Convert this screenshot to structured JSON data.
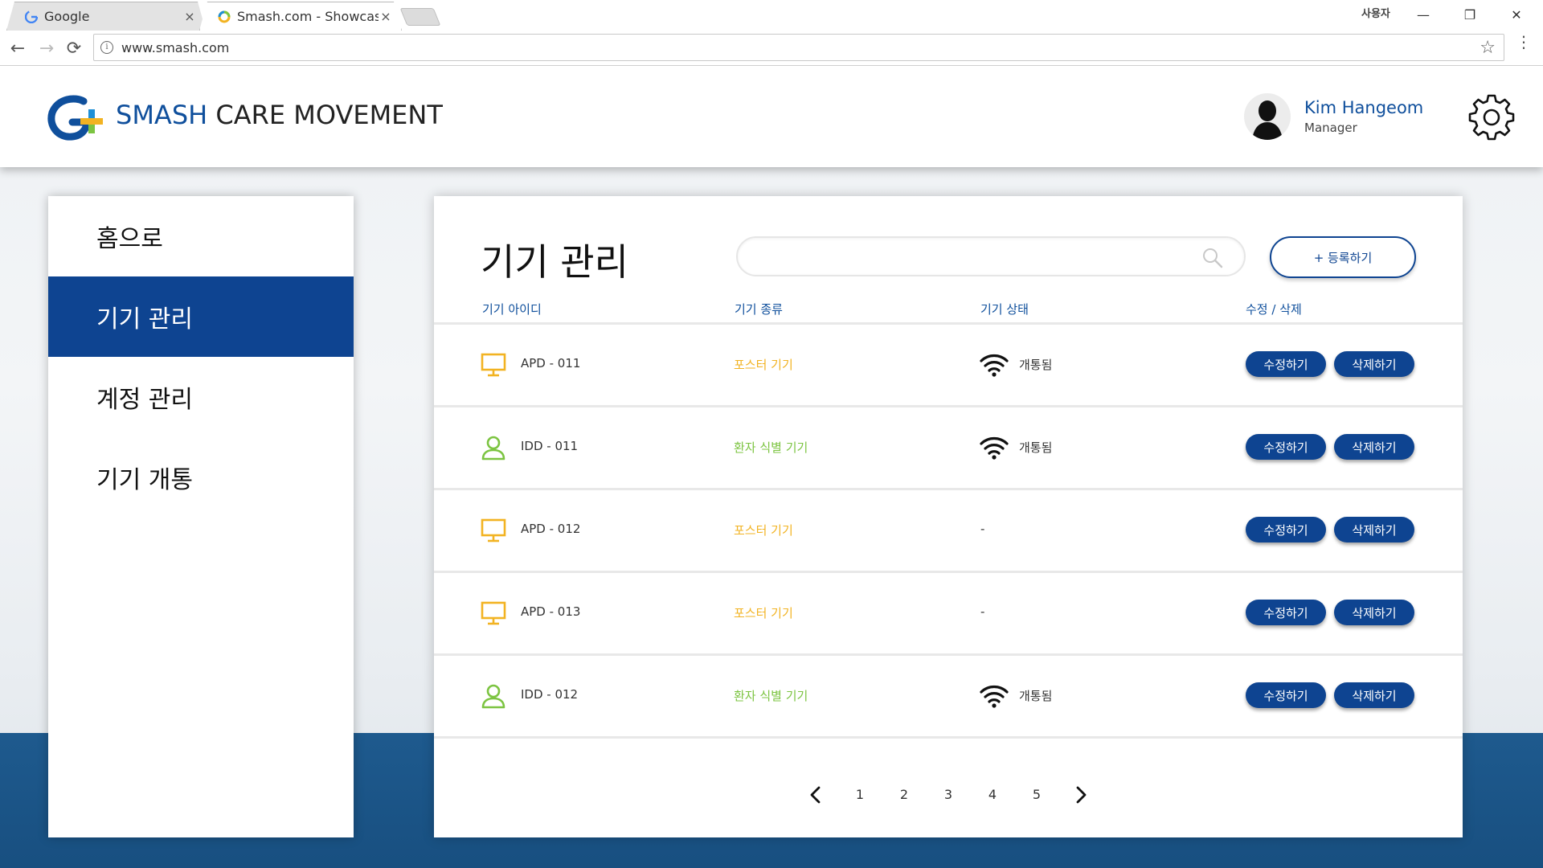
{
  "browser": {
    "tabs": [
      {
        "title": "Google",
        "close": "×"
      },
      {
        "title": "Smash.com - Showcasin",
        "close": "×"
      }
    ],
    "window_user": "사용자",
    "window_controls": {
      "minimize": "—",
      "restore": "❐",
      "close": "✕"
    },
    "url": "www.smash.com",
    "nav": {
      "back": "←",
      "forward": "→",
      "reload": "⟳"
    },
    "star": "☆",
    "menu": "⋮"
  },
  "header": {
    "brand_blue": "SMASH",
    "brand_dark": "CARE MOVEMENT",
    "user_name": "Kim Hangeom",
    "user_role": "Manager"
  },
  "sidebar": {
    "items": [
      {
        "label": "홈으로",
        "active": false
      },
      {
        "label": "기기 관리",
        "active": true
      },
      {
        "label": "계정 관리",
        "active": false
      },
      {
        "label": "기기 개통",
        "active": false
      }
    ]
  },
  "main": {
    "title": "기기 관리",
    "search_placeholder": "",
    "add_button": "+ 등록하기",
    "columns": [
      "기기 아이디",
      "기기 종류",
      "기기 상태",
      "수정 / 삭제"
    ],
    "rows": [
      {
        "icon": "monitor-icon",
        "id": "APD - 011",
        "type": "포스터 기기",
        "type_kind": "poster",
        "status": "개통됨",
        "wifi": true
      },
      {
        "icon": "person-icon",
        "id": "IDD - 011",
        "type": "환자 식별 기기",
        "type_kind": "patient",
        "status": "개통됨",
        "wifi": true
      },
      {
        "icon": "monitor-icon",
        "id": "APD - 012",
        "type": "포스터 기기",
        "type_kind": "poster",
        "status": "-",
        "wifi": false
      },
      {
        "icon": "monitor-icon",
        "id": "APD - 013",
        "type": "포스터 기기",
        "type_kind": "poster",
        "status": "-",
        "wifi": false
      },
      {
        "icon": "person-icon",
        "id": "IDD - 012",
        "type": "환자 식별 기기",
        "type_kind": "patient",
        "status": "개통됨",
        "wifi": true
      }
    ],
    "edit_label": "수정하기",
    "delete_label": "삭제하기",
    "pagination": {
      "pages": [
        "1",
        "2",
        "3",
        "4",
        "5"
      ]
    }
  },
  "colors": {
    "primary": "#0e4491",
    "poster": "#f2b322",
    "patient": "#7cc441"
  }
}
